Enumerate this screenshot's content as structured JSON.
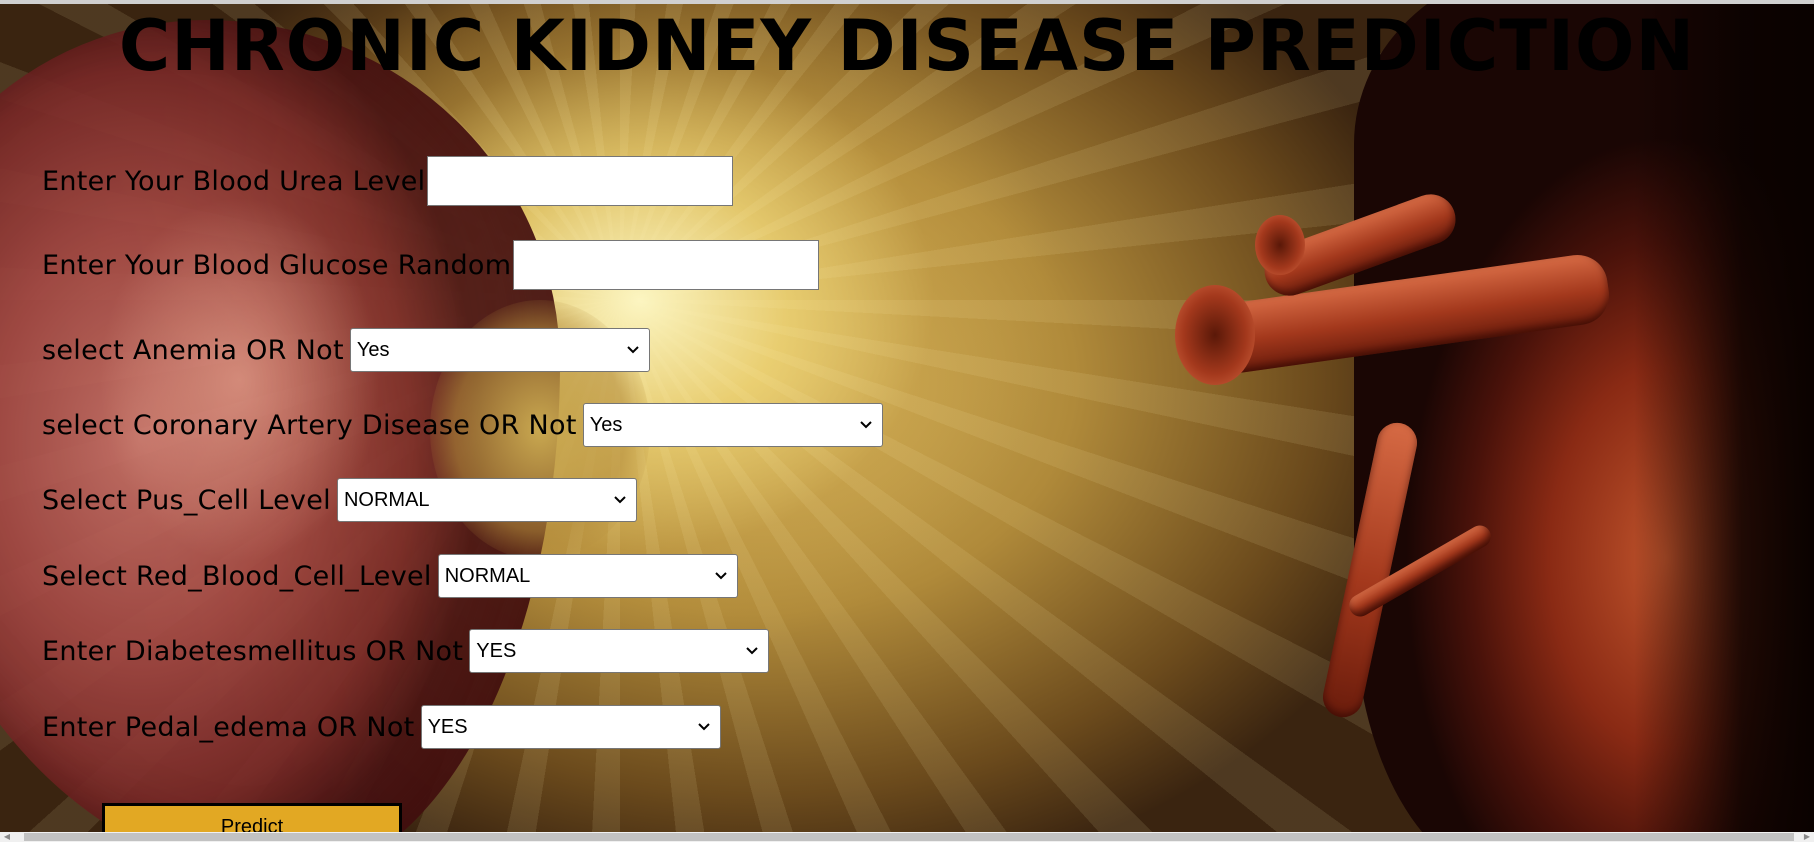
{
  "page": {
    "title": "CHRONIC KIDNEY DISEASE PREDICTION"
  },
  "form": {
    "blood_urea": {
      "label": "Enter Your Blood Urea Level",
      "value": ""
    },
    "blood_glucose": {
      "label": "Enter Your Blood Glucose Random",
      "value": ""
    },
    "anemia": {
      "label": "select Anemia OR Not",
      "selected": "Yes"
    },
    "coronary": {
      "label": "select Coronary Artery Disease OR Not",
      "selected": "Yes"
    },
    "pus_cell": {
      "label": "Select Pus_Cell Level",
      "selected": "NORMAL"
    },
    "red_blood_cell": {
      "label": "Select Red_Blood_Cell_Level",
      "selected": "NORMAL"
    },
    "diabetes": {
      "label": "Enter Diabetesmellitus OR Not",
      "selected": "YES"
    },
    "pedal_edema": {
      "label": "Enter Pedal_edema OR Not",
      "selected": "YES"
    },
    "submit_label": "Predict"
  },
  "theme": {
    "button_color": "#e2a823",
    "text_color": "#000000"
  },
  "icons": {
    "select_arrow": "chevron-down-icon",
    "scroll_left": "scroll-left-arrow-icon",
    "scroll_right": "scroll-right-arrow-icon"
  }
}
